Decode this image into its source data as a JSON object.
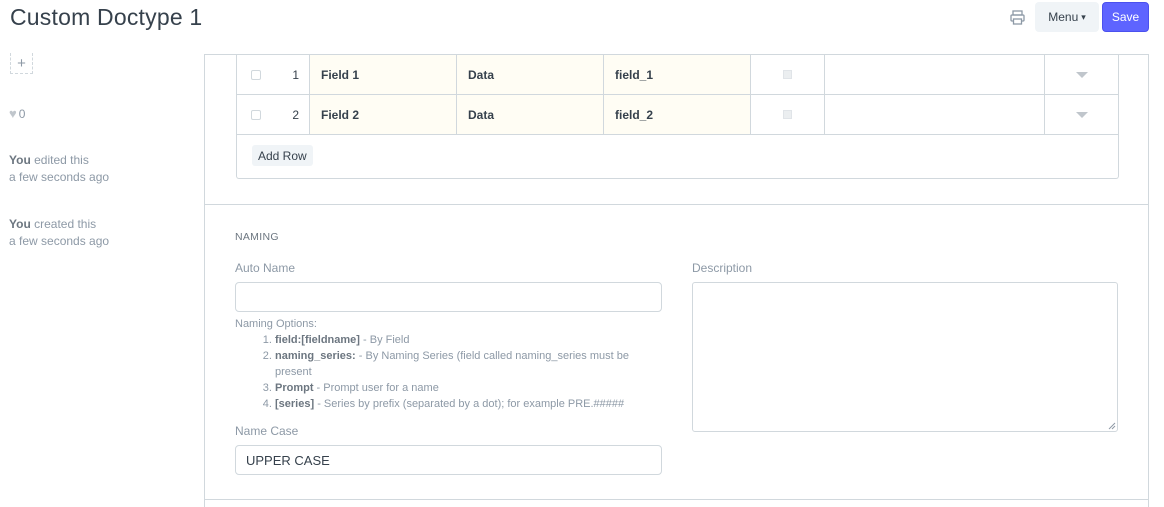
{
  "header": {
    "title": "Custom Doctype 1",
    "print_icon": "printer-icon",
    "menu_label": "Menu",
    "menu_caret": "▾",
    "save_label": "Save"
  },
  "sidebar": {
    "add_tag_symbol": "+",
    "likes_icon": "heart-icon",
    "likes_count": "0",
    "activity": [
      {
        "who": "You",
        "action": " edited this",
        "when": "a few seconds ago"
      },
      {
        "who": "You",
        "action": " created this",
        "when": "a few seconds ago"
      }
    ]
  },
  "fields_table": {
    "rows": [
      {
        "idx": "1",
        "label": "Field 1",
        "type": "Data",
        "name": "field_1"
      },
      {
        "idx": "2",
        "label": "Field 2",
        "type": "Data",
        "name": "field_2"
      }
    ],
    "add_row_label": "Add Row"
  },
  "naming": {
    "section_title": "NAMING",
    "auto_name_label": "Auto Name",
    "auto_name_value": "",
    "description_label": "Description",
    "help_intro": "Naming Options:",
    "options": [
      {
        "bold": "field:[fieldname]",
        "text": " - By Field"
      },
      {
        "bold": "naming_series:",
        "text": " - By Naming Series (field called naming_series must be present"
      },
      {
        "bold": "Prompt",
        "text": " - Prompt user for a name"
      },
      {
        "bold": "[series]",
        "text": " - Series by prefix (separated by a dot); for example PRE.#####"
      }
    ],
    "name_case_label": "Name Case",
    "name_case_value": "UPPER CASE"
  },
  "colors": {
    "primary": "#5e64ff",
    "text": "#36414c",
    "muted": "#8d99a6",
    "border": "#d1d8dd",
    "highlight_cell": "#fffdf4"
  }
}
